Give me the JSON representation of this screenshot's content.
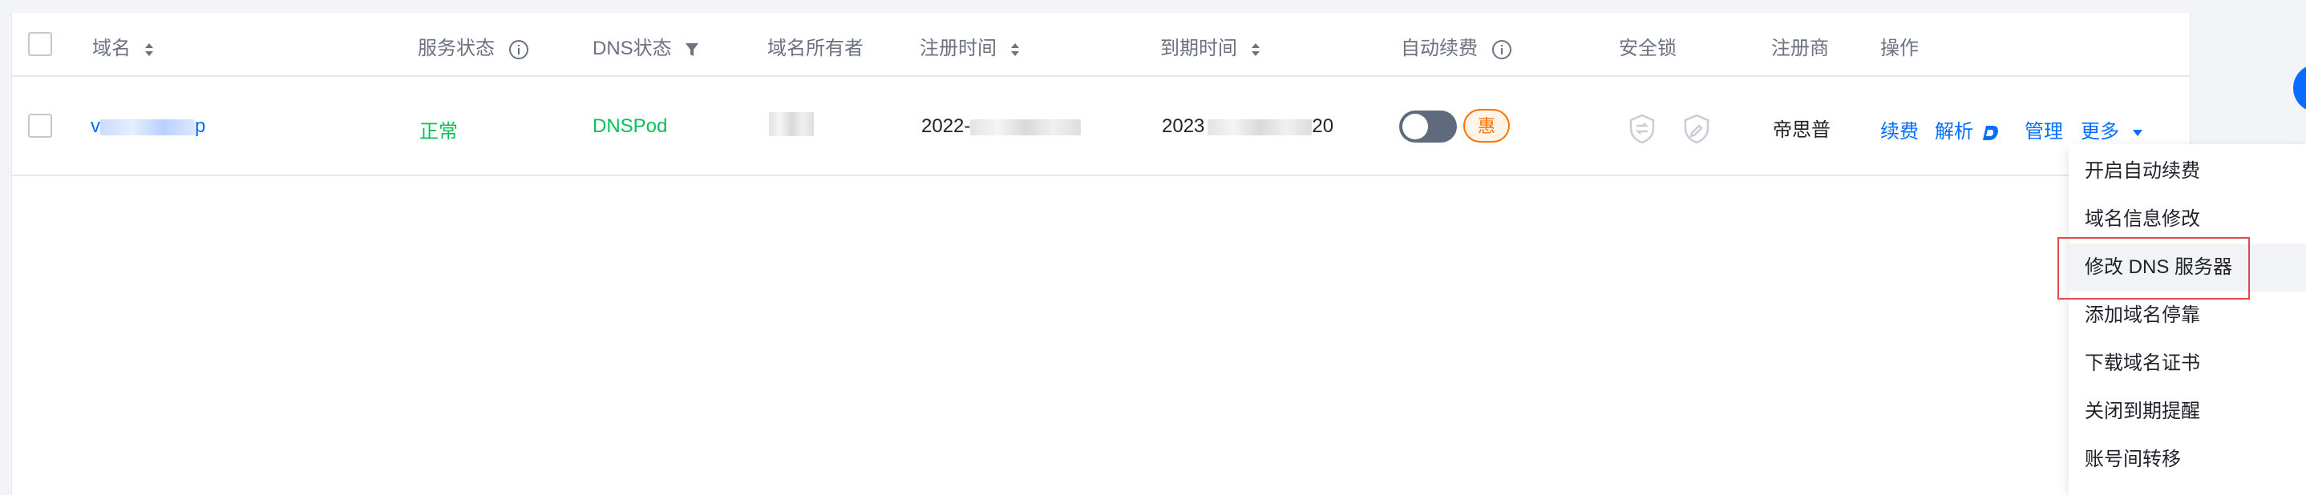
{
  "table": {
    "headers": {
      "domain": "域名",
      "service_status": "服务状态",
      "dns_status": "DNS状态",
      "owner": "域名所有者",
      "reg_time": "注册时间",
      "expire_time": "到期时间",
      "auto_renew": "自动续费",
      "security_lock": "安全锁",
      "registrar": "注册商",
      "actions": "操作"
    },
    "row": {
      "domain": "v",
      "domain_suffix": "p",
      "service_status": "正常",
      "dns_status": "DNSPod",
      "reg_time": "2022-",
      "expire_time_prefix": "2023",
      "expire_time_suffix": "20",
      "badge": "惠",
      "registrar": "帝思普",
      "actions": {
        "renew": "续费",
        "resolve": "解析",
        "manage": "管理",
        "more": "更多"
      }
    }
  },
  "dropdown": {
    "items": [
      "开启自动续费",
      "域名信息修改",
      "修改 DNS 服务器",
      "添加域名停靠",
      "下载域名证书",
      "关闭到期提醒",
      "账号间转移"
    ]
  },
  "colors": {
    "link": "#006eff",
    "green": "#0abf5b",
    "orange": "#ff7200",
    "highlight": "#e5484d"
  }
}
